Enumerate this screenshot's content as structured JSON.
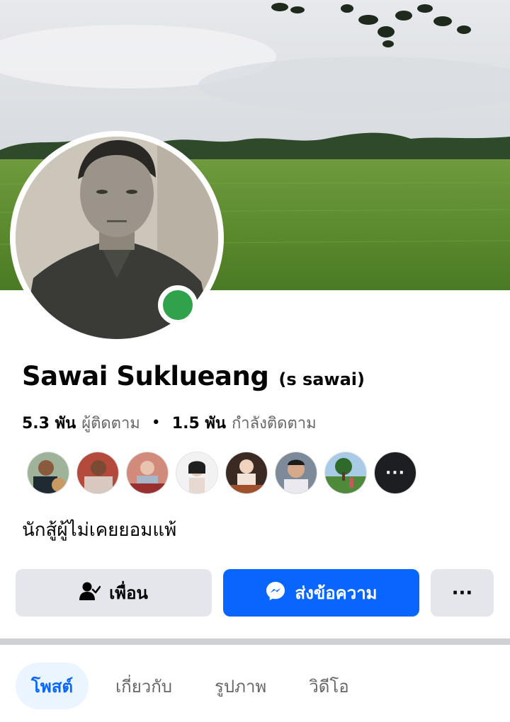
{
  "profile": {
    "name": "Sawai Suklueang",
    "alternate_name": "(s sawai)",
    "online": true,
    "bio": "นักสู้ผู้ไม่เคยยอมแพ้"
  },
  "stats": {
    "followers_count": "5.3 พัน",
    "followers_label": "ผู้ติดตาม",
    "separator": "•",
    "following_count": "1.5 พัน",
    "following_label": "กำลังติดตาม"
  },
  "friends": {
    "more_label": "···"
  },
  "actions": {
    "friends_label": "เพื่อน",
    "message_label": "ส่งข้อความ",
    "more_label": "···"
  },
  "tabs": [
    {
      "label": "โพสต์",
      "active": true
    },
    {
      "label": "เกี่ยวกับ",
      "active": false
    },
    {
      "label": "รูปภาพ",
      "active": false
    },
    {
      "label": "วิดีโอ",
      "active": false
    }
  ],
  "colors": {
    "accent": "#0866ff",
    "online": "#31a24c",
    "button_gray": "#e4e6eb",
    "tab_active_bg": "#ebf5ff"
  },
  "icons": {
    "friends_button": "person-check-icon",
    "message_button": "messenger-icon",
    "more_button": "more-horizontal-icon"
  }
}
